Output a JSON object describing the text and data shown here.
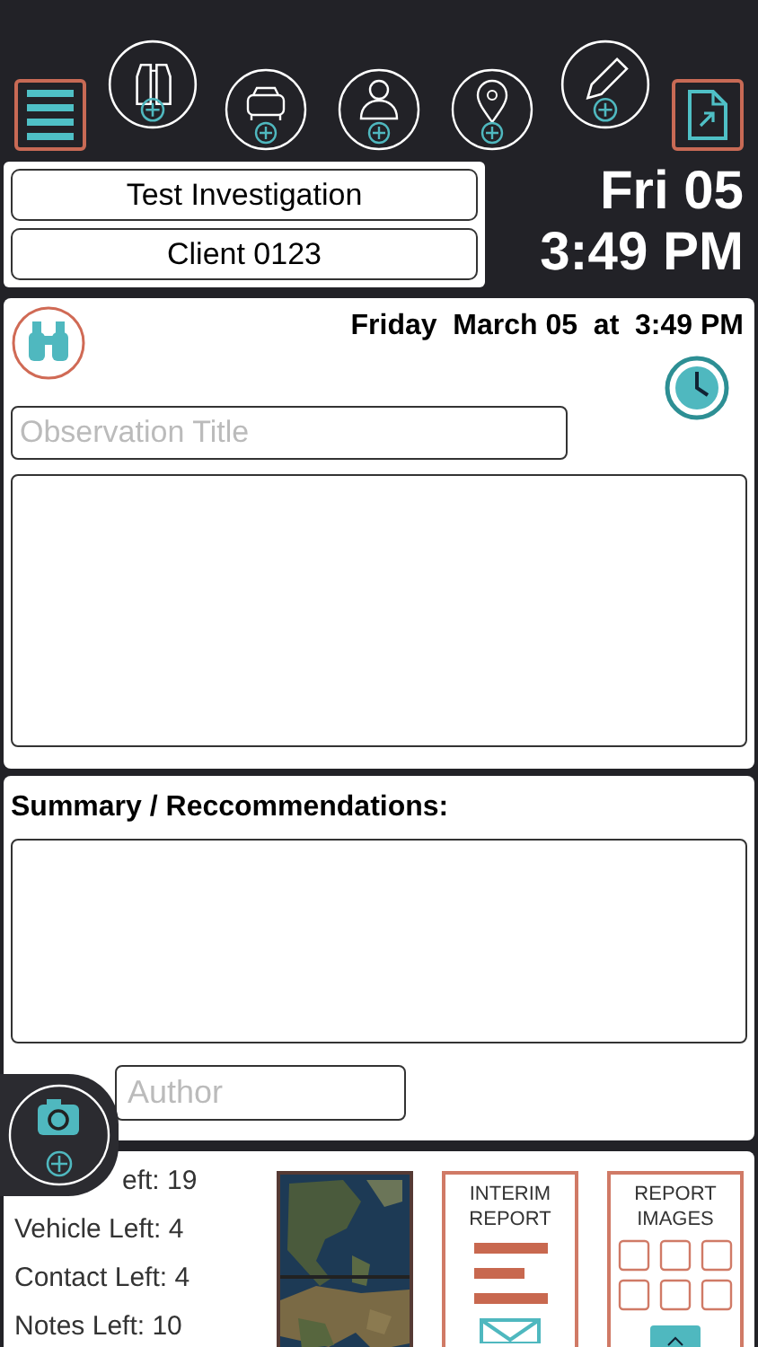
{
  "case": {
    "investigation": "Test Investigation",
    "client": "Client 0123"
  },
  "clock": {
    "date": "Fri 05",
    "time": "3:49 PM"
  },
  "observation": {
    "timestamp": "Friday  March 05  at  3:49 PM",
    "title_placeholder": "Observation Title"
  },
  "summary": {
    "label": "Summary / Reccommendations:",
    "author_placeholder": "Author"
  },
  "counts": [
    "eft: 19",
    "Vehicle Left: 4",
    "Contact Left: 4",
    "Notes Left: 10"
  ],
  "tiles": [
    {
      "kind": "map"
    },
    {
      "kind": "report",
      "label": "INTERIM REPORT"
    },
    {
      "kind": "images",
      "label": "REPORT IMAGES"
    }
  ]
}
